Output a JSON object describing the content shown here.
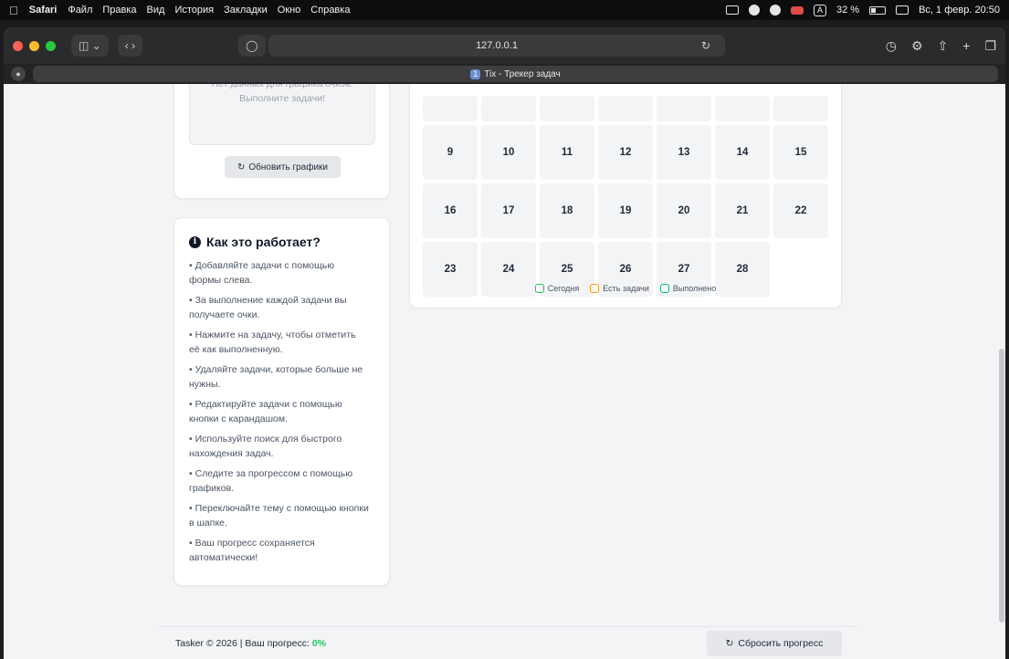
{
  "menubar": {
    "app": "Safari",
    "items": [
      "Файл",
      "Правка",
      "Вид",
      "История",
      "Закладки",
      "Окно",
      "Справка"
    ],
    "battery": "32 %",
    "datetime": "Вс, 1 февр. 20:50",
    "input_indicator": "A"
  },
  "browser": {
    "url": "127.0.0.1",
    "tab_number": "1",
    "tab_title": "Tix - Трекер задач"
  },
  "charts": {
    "empty_text": "Нет данных для графика очков. Выполните задачи!",
    "refresh_label": "Обновить графики"
  },
  "help": {
    "title": "Как это работает?",
    "items": [
      "• Добавляйте задачи с помощью формы слева.",
      "• За выполнение каждой задачи вы получаете очки.",
      "• Нажмите на задачу, чтобы отметить её как выполненную.",
      "• Удаляйте задачи, которые больше не нужны.",
      "• Редактируйте задачи с помощью кнопки с карандашом.",
      "• Используйте поиск для быстрого нахождения задач.",
      "• Следите за прогрессом с помощью графиков.",
      "• Переключайте тему с помощью кнопки в шапке.",
      "• Ваш прогресс сохраняется автоматически!"
    ]
  },
  "calendar": {
    "days": [
      "9",
      "10",
      "11",
      "12",
      "13",
      "14",
      "15",
      "16",
      "17",
      "18",
      "19",
      "20",
      "21",
      "22",
      "23",
      "24",
      "25",
      "26",
      "27",
      "28"
    ],
    "legend": [
      {
        "label": "Сегодня",
        "color": "#22c55e"
      },
      {
        "label": "Есть задачи",
        "color": "#f59e0b"
      },
      {
        "label": "Выполнено",
        "color": "#10b981"
      }
    ]
  },
  "footer": {
    "copyright": "Tasker © 2026 | Ваш прогресс:",
    "progress": "0%",
    "reset_label": "Сбросить прогресс"
  },
  "colors": {
    "accent_green": "#22c55e",
    "card_bg": "#ffffff",
    "page_bg": "#f3f4f6"
  }
}
